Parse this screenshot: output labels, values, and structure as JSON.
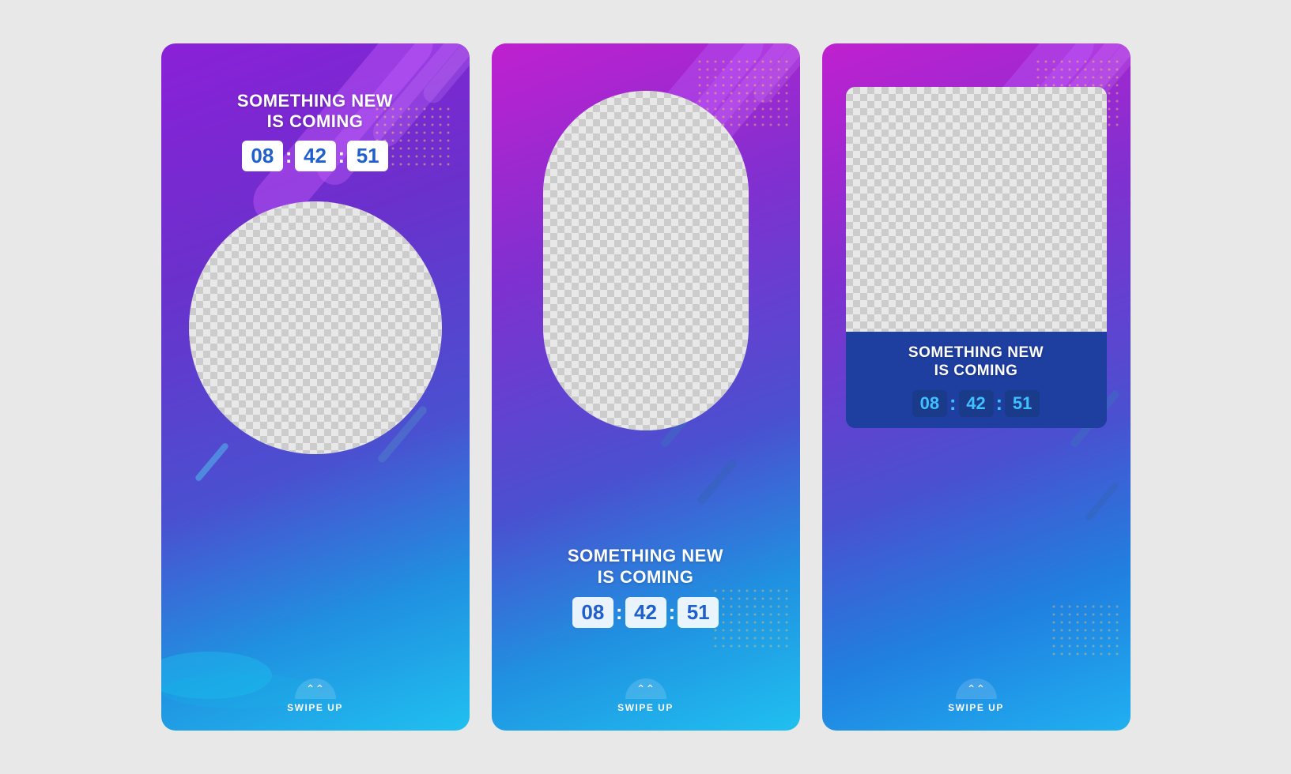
{
  "cards": [
    {
      "id": "card-1",
      "type": "circle",
      "heading": "SOMETHING NEW\nIS COMING",
      "timer": {
        "hours": "08",
        "minutes": "42",
        "seconds": "51"
      },
      "swipe_label": "SWIPE UP",
      "heading_top": true
    },
    {
      "id": "card-2",
      "type": "oval",
      "heading": "SOMETHING NEW\nIS COMING",
      "timer": {
        "hours": "08",
        "minutes": "42",
        "seconds": "51"
      },
      "swipe_label": "SWIPE UP",
      "heading_top": false
    },
    {
      "id": "card-3",
      "type": "rect",
      "heading": "SOMETHING NEW\nIS COMING",
      "timer": {
        "hours": "08",
        "minutes": "42",
        "seconds": "51"
      },
      "swipe_label": "SWIPE UP",
      "heading_top": false
    }
  ],
  "colors": {
    "purple_top": "#9b20e0",
    "blue_mid": "#4060d0",
    "blue_bottom": "#20b0f0",
    "stripe_light": "rgba(255,255,255,0.25)",
    "stripe_pink": "rgba(230,100,220,0.4)",
    "dark_box": "#1e3ea0"
  }
}
